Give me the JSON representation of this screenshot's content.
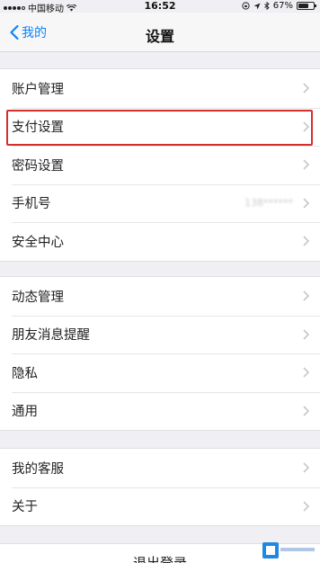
{
  "status_bar": {
    "carrier": "中国移动",
    "time": "16:52",
    "battery": "67%",
    "battery_level": 0.67
  },
  "nav": {
    "back_label": "我的",
    "title": "设置"
  },
  "groups": [
    {
      "items": [
        {
          "label": "账户管理",
          "value": ""
        },
        {
          "label": "支付设置",
          "value": "",
          "highlighted": true
        },
        {
          "label": "密码设置",
          "value": ""
        },
        {
          "label": "手机号",
          "value": "138******"
        },
        {
          "label": "安全中心",
          "value": ""
        }
      ]
    },
    {
      "items": [
        {
          "label": "动态管理"
        },
        {
          "label": "朋友消息提醒"
        },
        {
          "label": "隐私"
        },
        {
          "label": "通用"
        }
      ]
    },
    {
      "items": [
        {
          "label": "我的客服"
        },
        {
          "label": "关于"
        }
      ]
    }
  ],
  "logout_label": "退出登录"
}
